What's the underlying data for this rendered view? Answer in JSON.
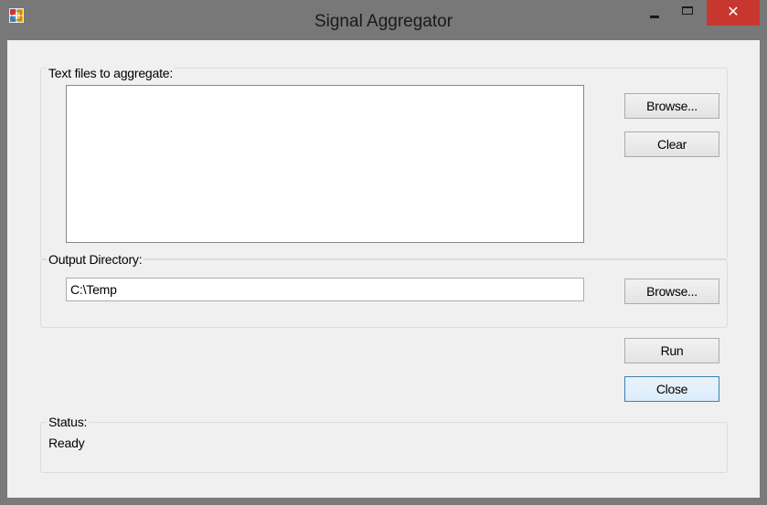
{
  "window": {
    "title": "Signal Aggregator",
    "close_glyph": "✕",
    "icons": {
      "app": "app-icon",
      "minimize": "minimize-icon",
      "maximize": "maximize-icon",
      "close": "close-icon"
    }
  },
  "files_group": {
    "label": "Text files to aggregate:",
    "files": [],
    "browse_label": "Browse...",
    "clear_label": "Clear"
  },
  "output_group": {
    "label": "Output Directory:",
    "directory_value": "C:\\Temp",
    "browse_label": "Browse..."
  },
  "actions": {
    "run_label": "Run",
    "close_label": "Close"
  },
  "status_group": {
    "label": "Status:",
    "status_text": "Ready"
  },
  "colors": {
    "titlebar": "#787878",
    "close_button": "#c7372f",
    "client_background": "#f0f0f0"
  }
}
